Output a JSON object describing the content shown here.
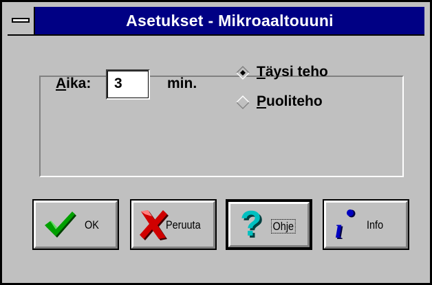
{
  "window": {
    "title": "Asetukset - Mikroaaltouuni"
  },
  "settings": {
    "time_label_prefix": "A",
    "time_label_rest": "ika:",
    "time_value": "3",
    "time_unit": "min.",
    "power_options": [
      {
        "accel": "T",
        "rest": "äysi teho",
        "selected": true
      },
      {
        "accel": "P",
        "rest": "uoliteho",
        "selected": false
      }
    ]
  },
  "buttons": {
    "ok": {
      "label": "OK",
      "icon": "checkmark-icon"
    },
    "cancel": {
      "label": "Peruuta",
      "icon": "red-x-icon"
    },
    "help": {
      "label": "Ohje",
      "icon": "question-mark-icon"
    },
    "info": {
      "label": "Info",
      "icon": "info-icon"
    }
  },
  "colors": {
    "title_bar": "#000084",
    "face": "#c0c0c0",
    "check_green": "#00a000",
    "cancel_red": "#d00000",
    "help_cyan": "#00c0c0",
    "info_blue": "#0000c0"
  }
}
